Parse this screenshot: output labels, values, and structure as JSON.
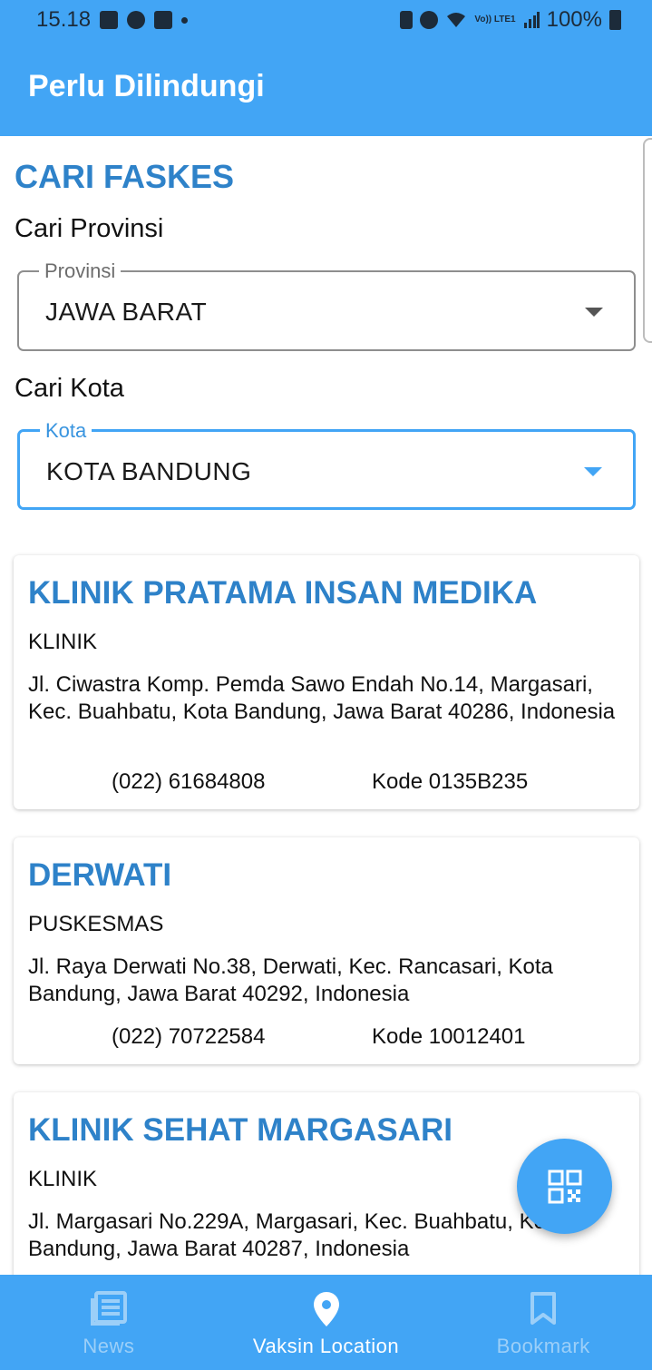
{
  "status_bar": {
    "time": "15.18",
    "battery": "100%",
    "left_icons": [
      "gallery-icon",
      "notification-app-icon",
      "teams-icon",
      "dot-icon"
    ],
    "right_icons": [
      "lock-icon",
      "alarm-icon",
      "wifi-icon",
      "volte-icon",
      "signal-icon",
      "battery-icon"
    ],
    "volte_text": "Vo)) LTE1"
  },
  "app_bar": {
    "title": "Perlu Dilindungi"
  },
  "search": {
    "title": "CARI FASKES",
    "province_label": "Cari Provinsi",
    "province_legend": "Provinsi",
    "province_value": "JAWA BARAT",
    "city_label": "Cari Kota",
    "city_legend": "Kota",
    "city_value": "KOTA BANDUNG"
  },
  "faskes": [
    {
      "name": "KLINIK PRATAMA INSAN MEDIKA",
      "type": "KLINIK",
      "address": "Jl. Ciwastra Komp. Pemda Sawo Endah No.14, Margasari, Kec. Buahbatu, Kota Bandung, Jawa Barat 40286, Indonesia",
      "phone": "(022) 61684808",
      "code": "Kode 0135B235"
    },
    {
      "name": "DERWATI",
      "type": "PUSKESMAS",
      "address": "Jl. Raya Derwati No.38, Derwati, Kec. Rancasari, Kota Bandung, Jawa Barat 40292, Indonesia",
      "phone": "(022) 70722584",
      "code": "Kode 10012401"
    },
    {
      "name": "KLINIK SEHAT MARGASARI",
      "type": "KLINIK",
      "address": "Jl. Margasari No.229A, Margasari, Kec. Buahbatu, Kota Bandung, Jawa Barat 40287, Indonesia",
      "phone": "",
      "code": ""
    }
  ],
  "fab": {
    "icon": "qr-code-icon"
  },
  "bottom_nav": {
    "items": [
      {
        "label": "News",
        "icon": "news-icon",
        "active": false
      },
      {
        "label": "Vaksin Location",
        "icon": "location-pin-icon",
        "active": true
      },
      {
        "label": "Bookmark",
        "icon": "bookmark-icon",
        "active": false
      }
    ]
  },
  "colors": {
    "primary": "#42a5f5",
    "accent_text": "#2e82c9",
    "inactive_nav": "#9ccff8"
  }
}
